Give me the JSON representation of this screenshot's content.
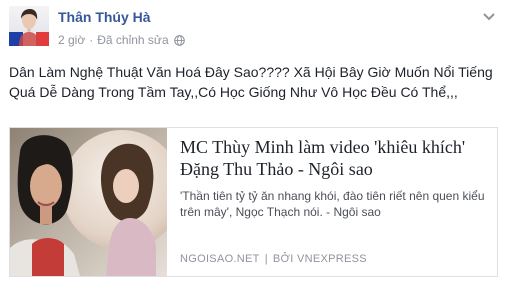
{
  "post": {
    "author": "Thân Thúy Hà",
    "time": "2 giờ",
    "separator": "·",
    "edited": "Đã chỉnh sửa",
    "icons": {
      "privacy": "globe-icon",
      "options": "chevron-down-icon"
    },
    "text": "Dân Làm Nghệ Thuật Văn Hoá Đây Sao???? Xã Hội Bây Giờ Muốn Nổi Tiếng Quá Dễ Dàng Trong Tầm Tay,,Có Học Giống Như Vô Học Đều Có Thể,,,"
  },
  "link_preview": {
    "title": "MC Thùy Minh làm video 'khiêu khích' Đặng Thu Thảo - Ngôi sao",
    "description": "'Thần tiên tỷ tỷ ăn nhang khói, đào tiên riết nên quen kiểu trên mây', Ngọc Thạch nói. - Ngôi sao",
    "domain": "NGOISAO.NET",
    "divider": "|",
    "by": "BỞI VNEXPRESS"
  },
  "colors": {
    "author_link": "#365899",
    "meta_gray": "#90949c",
    "text": "#1d2129",
    "card_border": "#dddfe2"
  }
}
